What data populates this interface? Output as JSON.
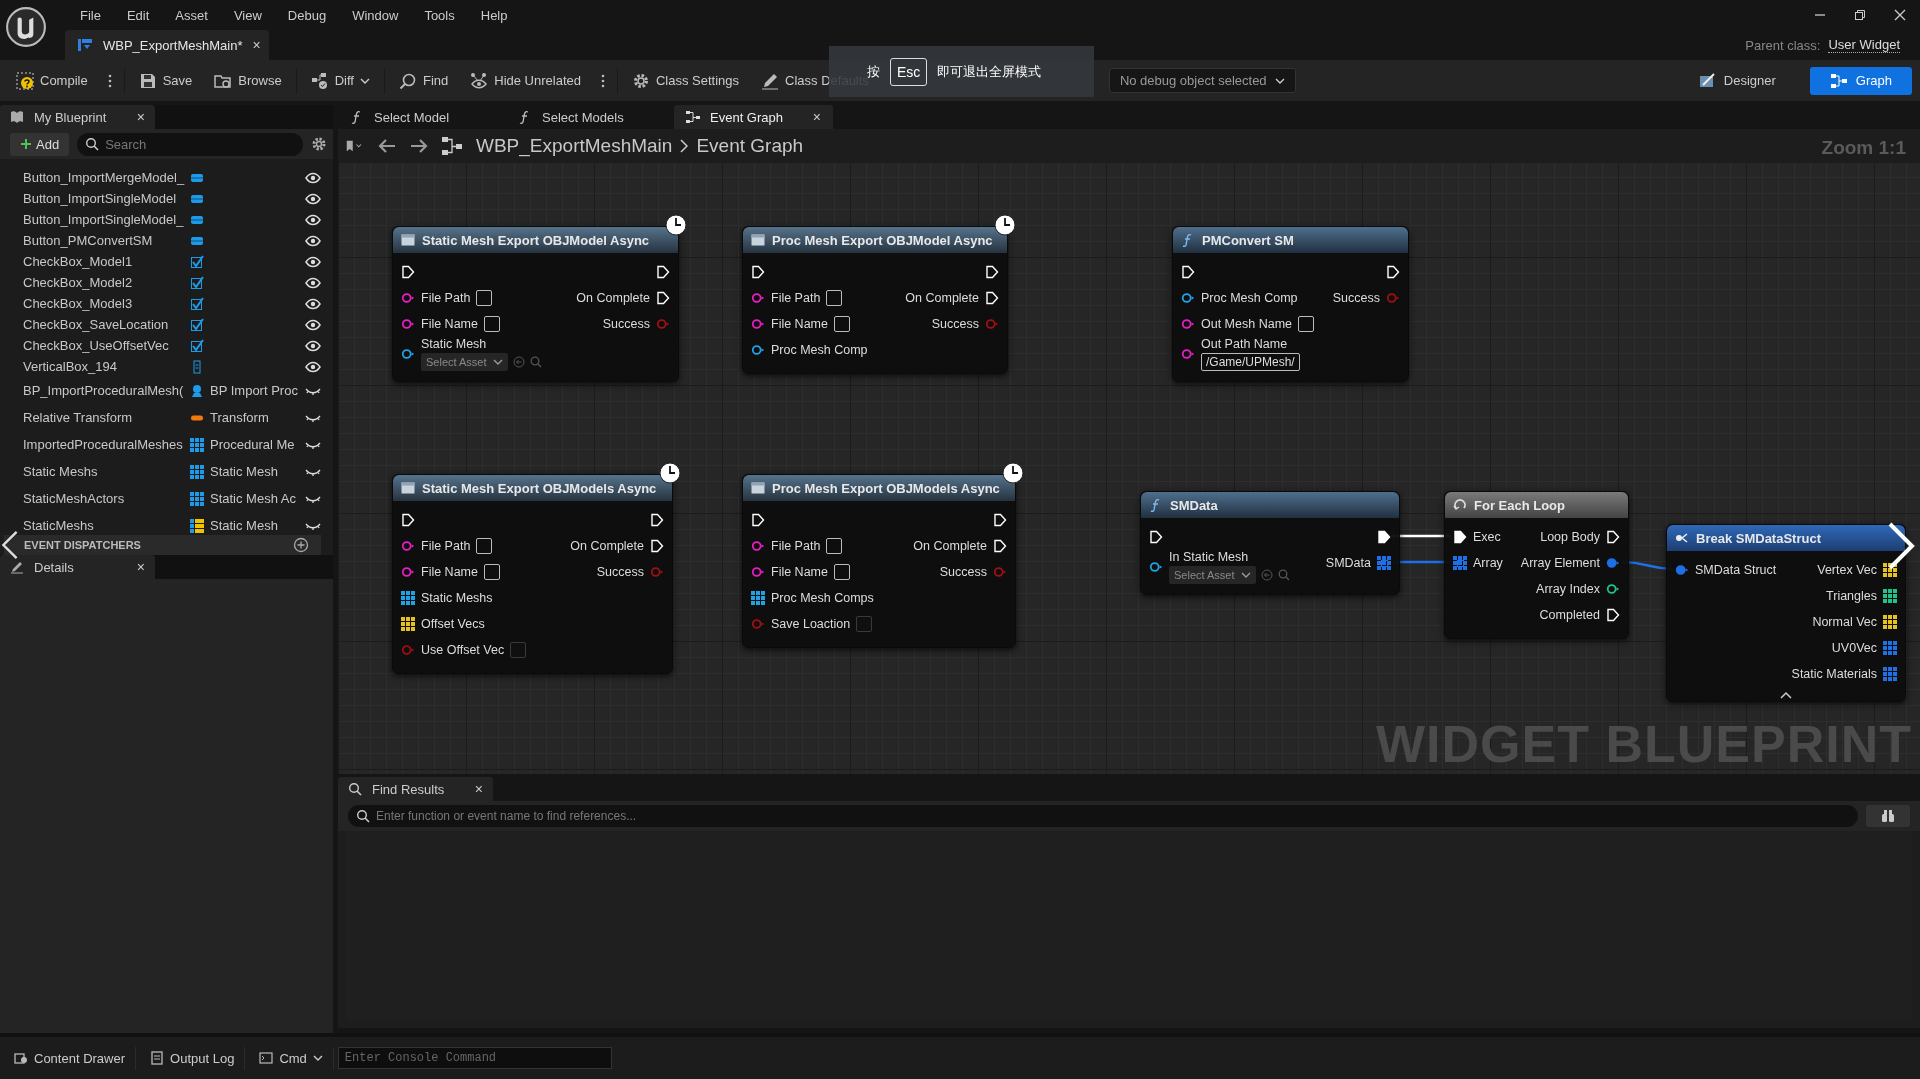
{
  "menu": [
    "File",
    "Edit",
    "Asset",
    "View",
    "Debug",
    "Window",
    "Tools",
    "Help"
  ],
  "asset_tab": {
    "title": "WBP_ExportMeshMain*",
    "close": "×"
  },
  "parent_class": {
    "label": "Parent class:",
    "value": "User Widget"
  },
  "toolbar": [
    {
      "kind": "compile",
      "label": "Compile"
    },
    {
      "kind": "more"
    },
    {
      "kind": "save",
      "label": "Save"
    },
    {
      "kind": "browse",
      "label": "Browse"
    },
    {
      "kind": "diff",
      "label": "Diff"
    },
    {
      "kind": "find",
      "label": "Find"
    },
    {
      "kind": "hide",
      "label": "Hide Unrelated"
    },
    {
      "kind": "more"
    },
    {
      "kind": "settings",
      "label": "Class Settings"
    },
    {
      "kind": "defaults",
      "label": "Class Defaults"
    }
  ],
  "debug_selector": "No debug object selected",
  "modes": [
    {
      "label": "Designer",
      "selected": false
    },
    {
      "label": "Graph",
      "selected": true
    }
  ],
  "fullscreen_notice": {
    "before": "按",
    "key": "Esc",
    "after": "即可退出全屏模式"
  },
  "my_blueprint": {
    "title": "My Blueprint",
    "close": "×",
    "add": "Add",
    "search_placeholder": "Search",
    "variables": [
      {
        "name": "Button_ImportMergeModel_",
        "kind": "button",
        "visible": true
      },
      {
        "name": "Button_ImportSingleModel",
        "kind": "button",
        "visible": true
      },
      {
        "name": "Button_ImportSingleModel_",
        "kind": "button",
        "visible": true
      },
      {
        "name": "Button_PMConvertSM",
        "kind": "button",
        "visible": true
      },
      {
        "name": "CheckBox_Model1",
        "kind": "checkbox",
        "visible": true
      },
      {
        "name": "CheckBox_Model2",
        "kind": "checkbox",
        "visible": true
      },
      {
        "name": "CheckBox_Model3",
        "kind": "checkbox",
        "visible": true
      },
      {
        "name": "CheckBox_SaveLocation",
        "kind": "checkbox",
        "visible": true
      },
      {
        "name": "CheckBox_UseOffsetVec",
        "kind": "checkbox",
        "visible": true
      },
      {
        "name": "VerticalBox_194",
        "kind": "vbox",
        "visible": true
      },
      {
        "name": "BP_ImportProceduralMesh(",
        "kind": "actor",
        "type_label": "BP Import Proc",
        "visible": false
      },
      {
        "name": "Relative Transform",
        "kind": "transform",
        "type_label": "Transform",
        "visible": false
      },
      {
        "name": "ImportedProceduralMeshes",
        "kind": "array",
        "type_label": "Procedural Me",
        "visible": false
      },
      {
        "name": "Static Meshs",
        "kind": "array",
        "type_label": "Static Mesh",
        "visible": false
      },
      {
        "name": "StaticMeshActors",
        "kind": "array",
        "type_label": "Static Mesh Ac",
        "visible": false
      },
      {
        "name": "StaticMeshs",
        "kind": "map",
        "type_label": "Static Mesh",
        "visible": false
      }
    ],
    "section": "EVENT DISPATCHERS"
  },
  "details": {
    "title": "Details",
    "close": "×"
  },
  "doc_tabs": [
    {
      "label": "Select Model",
      "selected": false
    },
    {
      "label": "Select Models",
      "selected": false
    },
    {
      "label": "Event Graph",
      "selected": true,
      "close": "×"
    }
  ],
  "breadcrumb": [
    "WBP_ExportMeshMain",
    "Event Graph"
  ],
  "zoom": "Zoom 1:1",
  "graph_watermark": "WIDGET BLUEPRINT",
  "nodes": [
    {
      "kind": "async",
      "title": "Static Mesh Export OBJModel Async",
      "inputs": [
        {
          "kind": "exec",
          "connected": false
        },
        {
          "kind": "ring",
          "label": "File Path",
          "color": "#e61fc4",
          "connected": false,
          "field": {
            "kind": "box"
          }
        },
        {
          "kind": "ring",
          "label": "File Name",
          "color": "#e61fc4",
          "connected": false,
          "field": {
            "kind": "box"
          }
        },
        {
          "kind": "ring",
          "label": "Static Mesh",
          "color": "#1fa3e6",
          "connected": false,
          "field": {
            "kind": "asset",
            "value": "Select Asset"
          }
        }
      ],
      "outputs": [
        {
          "kind": "exec",
          "connected": false
        },
        {
          "kind": "exec",
          "label": "On Complete",
          "connected": false
        },
        {
          "kind": "ring",
          "label": "Success",
          "color": "#a01010",
          "connected": false
        }
      ]
    },
    {
      "kind": "async",
      "title": "Proc Mesh Export OBJModel Async",
      "inputs": [
        {
          "kind": "exec",
          "connected": false
        },
        {
          "kind": "ring",
          "label": "File Path",
          "color": "#e61fc4",
          "connected": false,
          "field": {
            "kind": "box"
          }
        },
        {
          "kind": "ring",
          "label": "File Name",
          "color": "#e61fc4",
          "connected": false,
          "field": {
            "kind": "box"
          }
        },
        {
          "kind": "ring",
          "label": "Proc Mesh Comp",
          "color": "#1fa3e6",
          "connected": false
        }
      ],
      "outputs": [
        {
          "kind": "exec",
          "connected": false
        },
        {
          "kind": "exec",
          "label": "On Complete",
          "connected": false
        },
        {
          "kind": "ring",
          "label": "Success",
          "color": "#a01010",
          "connected": false
        }
      ]
    },
    {
      "kind": "function",
      "title": "PMConvert SM",
      "inputs": [
        {
          "kind": "exec",
          "connected": false
        },
        {
          "kind": "ring",
          "label": "Proc Mesh Comp",
          "color": "#1fa3e6",
          "connected": false
        },
        {
          "kind": "ring",
          "label": "Out Mesh Name",
          "color": "#e61fc4",
          "connected": false,
          "field": {
            "kind": "box"
          }
        },
        {
          "kind": "ring",
          "label": "Out Path Name",
          "color": "#e61fc4",
          "connected": false,
          "field": {
            "kind": "text",
            "value": "/Game/UPMesh/"
          }
        }
      ],
      "outputs": [
        {
          "kind": "exec",
          "connected": false
        },
        {
          "kind": "ring",
          "label": "Success",
          "color": "#a01010",
          "connected": false
        }
      ]
    },
    {
      "kind": "async",
      "title": "Static Mesh Export OBJModels Async",
      "inputs": [
        {
          "kind": "exec",
          "connected": false
        },
        {
          "kind": "ring",
          "label": "File Path",
          "color": "#e61fc4",
          "connected": false,
          "field": {
            "kind": "box"
          }
        },
        {
          "kind": "ring",
          "label": "File Name",
          "color": "#e61fc4",
          "connected": false,
          "field": {
            "kind": "box"
          }
        },
        {
          "kind": "array",
          "label": "Static Meshs",
          "color": "#1fa3e6",
          "connected": false
        },
        {
          "kind": "array",
          "label": "Offset Vecs",
          "color": "#e6c21f",
          "connected": false
        },
        {
          "kind": "ring",
          "label": "Use Offset Vec",
          "color": "#a01010",
          "connected": false,
          "field": {
            "kind": "check",
            "checked": false
          }
        }
      ],
      "outputs": [
        {
          "kind": "exec",
          "connected": false
        },
        {
          "kind": "exec",
          "label": "On Complete",
          "connected": false
        },
        {
          "kind": "ring",
          "label": "Success",
          "color": "#a01010",
          "connected": false
        }
      ]
    },
    {
      "kind": "async",
      "title": "Proc Mesh Export OBJModels Async",
      "inputs": [
        {
          "kind": "exec",
          "connected": false
        },
        {
          "kind": "ring",
          "label": "File Path",
          "color": "#e61fc4",
          "connected": false,
          "field": {
            "kind": "box"
          }
        },
        {
          "kind": "ring",
          "label": "File Name",
          "color": "#e61fc4",
          "connected": false,
          "field": {
            "kind": "box"
          }
        },
        {
          "kind": "array",
          "label": "Proc Mesh Comps",
          "color": "#1fa3e6",
          "connected": false
        },
        {
          "kind": "ring",
          "label": "Save Loaction",
          "color": "#a01010",
          "connected": false,
          "field": {
            "kind": "check",
            "checked": false
          }
        }
      ],
      "outputs": [
        {
          "kind": "exec",
          "connected": false
        },
        {
          "kind": "exec",
          "label": "On Complete",
          "connected": false
        },
        {
          "kind": "ring",
          "label": "Success",
          "color": "#a01010",
          "connected": false
        }
      ]
    },
    {
      "kind": "function",
      "title": "SMData",
      "inputs": [
        {
          "kind": "exec",
          "connected": false
        },
        {
          "kind": "ring",
          "label": "In Static Mesh",
          "color": "#1fa3e6",
          "connected": false,
          "field": {
            "kind": "asset",
            "value": "Select Asset"
          }
        }
      ],
      "outputs": [
        {
          "kind": "exec",
          "connected": true
        },
        {
          "kind": "array",
          "label": "SMData",
          "color": "#1f6fe6",
          "connected": true
        }
      ]
    },
    {
      "kind": "macro",
      "title": "For Each Loop",
      "inputs": [
        {
          "kind": "exec",
          "label": "Exec",
          "connected": true
        },
        {
          "kind": "array",
          "label": "Array",
          "color": "#1f6fe6",
          "connected": true
        }
      ],
      "outputs": [
        {
          "kind": "exec",
          "label": "Loop Body",
          "connected": false
        },
        {
          "kind": "ring",
          "label": "Array Element",
          "color": "#1f6fe6",
          "connected": true
        },
        {
          "kind": "ring",
          "label": "Array Index",
          "color": "#1fc48a",
          "connected": false
        },
        {
          "kind": "exec",
          "label": "Completed",
          "connected": false
        }
      ]
    },
    {
      "kind": "struct",
      "title": "Break SMDataStruct",
      "inputs": [
        {
          "kind": "ring",
          "label": "SMData Struct",
          "color": "#1f6fe6",
          "connected": true
        }
      ],
      "outputs": [
        {
          "kind": "array",
          "label": "Vertex Vec",
          "color": "#e6c21f",
          "connected": false
        },
        {
          "kind": "array",
          "label": "Triangles",
          "color": "#1fc48a",
          "connected": false
        },
        {
          "kind": "array",
          "label": "Normal Vec",
          "color": "#e6c21f",
          "connected": false
        },
        {
          "kind": "array",
          "label": "UV0Vec",
          "color": "#1f6fe6",
          "connected": false
        },
        {
          "kind": "array",
          "label": "Static Materials",
          "color": "#1f6fe6",
          "connected": false
        }
      ]
    }
  ],
  "find_results": {
    "title": "Find Results",
    "close": "×",
    "placeholder": "Enter function or event name to find references..."
  },
  "status_bar": {
    "content_drawer": "Content Drawer",
    "output_log": "Output Log",
    "cmd": "Cmd",
    "console_placeholder": "Enter Console Command"
  }
}
